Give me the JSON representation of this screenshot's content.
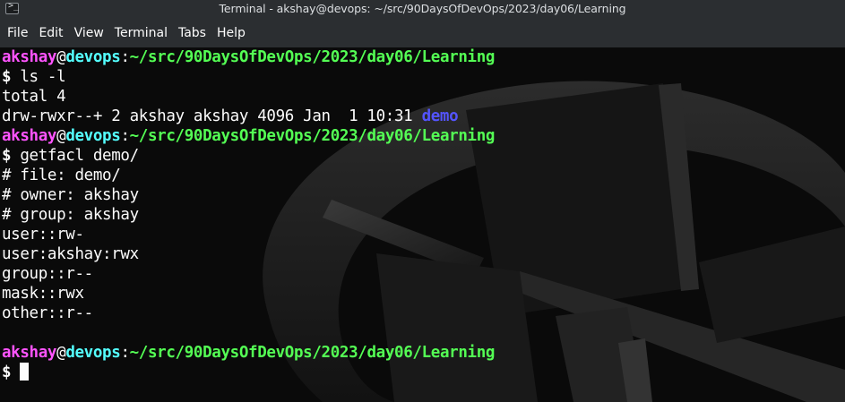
{
  "window": {
    "title": "Terminal - akshay@devops: ~/src/90DaysOfDevOps/2023/day06/Learning",
    "icon": "terminal-icon"
  },
  "menu": [
    "File",
    "Edit",
    "View",
    "Terminal",
    "Tabs",
    "Help"
  ],
  "prompt": {
    "user": "akshay",
    "at": "@",
    "host": "devops",
    "colon": ":",
    "path": "~/src/90DaysOfDevOps/2023/day06/Learning",
    "symbol": "$"
  },
  "commands": {
    "ls": "ls -l",
    "getfacl": "getfacl demo/"
  },
  "ls_output": {
    "total": "total 4",
    "entry_meta": "drw-rwxr--+ 2 akshay akshay 4096 Jan  1 10:31 ",
    "entry_name": "demo"
  },
  "getfacl_output": [
    "# file: demo/",
    "# owner: akshay",
    "# group: akshay",
    "user::rw-",
    "user:akshay:rwx",
    "group::r--",
    "mask::rwx",
    "other::r--"
  ],
  "colors": {
    "user": "#ff54ff",
    "host": "#54ffff",
    "path": "#54ff54",
    "directory": "#5454ff",
    "text": "#fcfcfc",
    "background": "#0a0a0a",
    "chrome": "#2b2e31"
  }
}
